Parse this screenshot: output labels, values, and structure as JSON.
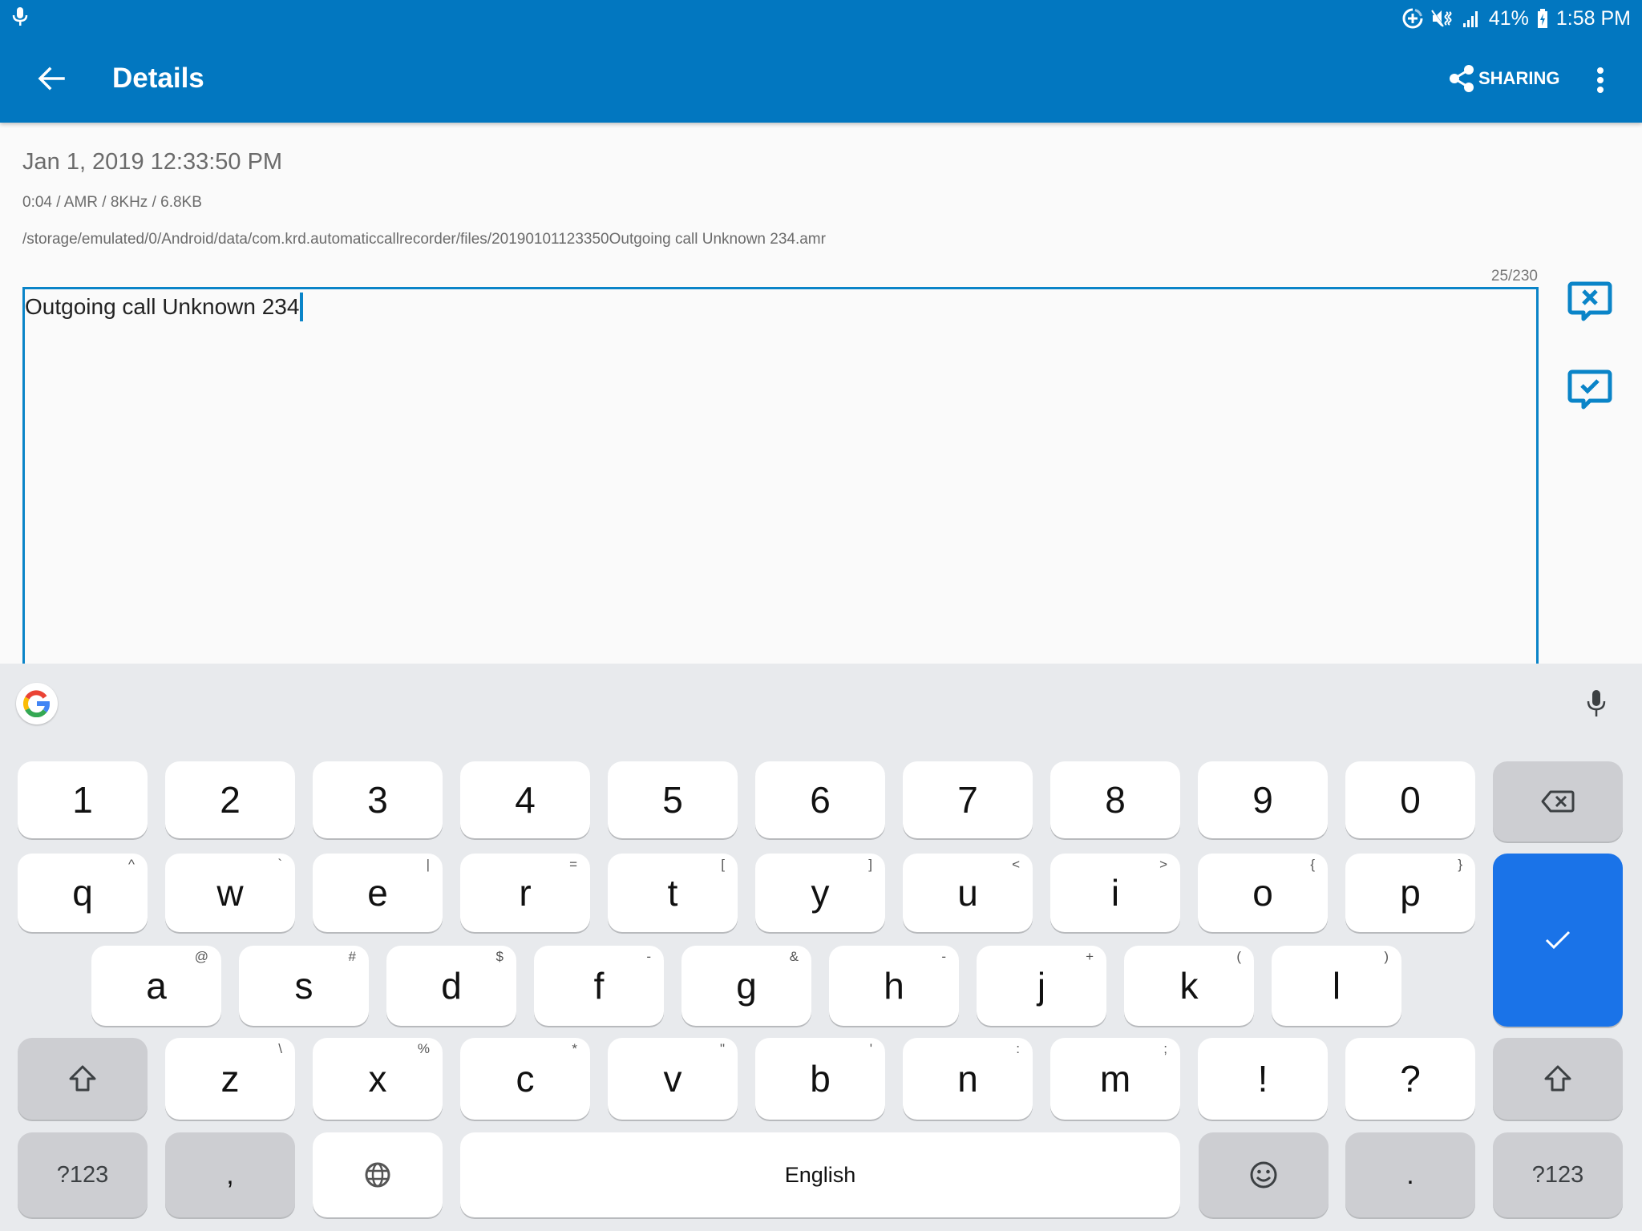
{
  "status_bar": {
    "battery": "41%",
    "time": "1:58 PM"
  },
  "app_bar": {
    "title": "Details",
    "sharing_label": "SHARING",
    "color": "#0277C0"
  },
  "recording": {
    "date": "Jan 1, 2019 12:33:50 PM",
    "meta": "0:04 / AMR / 8KHz / 6.8KB",
    "path": "/storage/emulated/0/Android/data/com.krd.automaticcallrecorder/files/20190101123350Outgoing call Unknown 234.amr"
  },
  "note": {
    "counter": "25/230",
    "value": "Outgoing call Unknown 234"
  },
  "side_actions": [
    {
      "name": "discard-note",
      "icon": "comment-x-icon"
    },
    {
      "name": "save-note",
      "icon": "comment-check-icon"
    }
  ],
  "keyboard": {
    "accent": "#1A73E8",
    "rows": [
      [
        {
          "label": "1"
        },
        {
          "label": "2"
        },
        {
          "label": "3"
        },
        {
          "label": "4"
        },
        {
          "label": "5"
        },
        {
          "label": "6"
        },
        {
          "label": "7"
        },
        {
          "label": "8"
        },
        {
          "label": "9"
        },
        {
          "label": "0"
        }
      ],
      [
        {
          "label": "q",
          "hint": "^"
        },
        {
          "label": "w",
          "hint": "`"
        },
        {
          "label": "e",
          "hint": "|"
        },
        {
          "label": "r",
          "hint": "="
        },
        {
          "label": "t",
          "hint": "["
        },
        {
          "label": "y",
          "hint": "]"
        },
        {
          "label": "u",
          "hint": "<"
        },
        {
          "label": "i",
          "hint": ">"
        },
        {
          "label": "o",
          "hint": "{"
        },
        {
          "label": "p",
          "hint": "}"
        }
      ],
      [
        {
          "label": "a",
          "hint": "@"
        },
        {
          "label": "s",
          "hint": "#"
        },
        {
          "label": "d",
          "hint": "$"
        },
        {
          "label": "f",
          "hint": "-"
        },
        {
          "label": "g",
          "hint": "&"
        },
        {
          "label": "h",
          "hint": "-"
        },
        {
          "label": "j",
          "hint": "+"
        },
        {
          "label": "k",
          "hint": "("
        },
        {
          "label": "l",
          "hint": ")"
        }
      ],
      [
        {
          "label": "z",
          "hint": "\\"
        },
        {
          "label": "x",
          "hint": "%"
        },
        {
          "label": "c",
          "hint": "*"
        },
        {
          "label": "v",
          "hint": "\""
        },
        {
          "label": "b",
          "hint": "'"
        },
        {
          "label": "n",
          "hint": ":"
        },
        {
          "label": "m",
          "hint": ";"
        },
        {
          "label": "!"
        },
        {
          "label": "?"
        }
      ]
    ],
    "bottom_row": {
      "symbols_left": "?123",
      "comma": ",",
      "space": "English",
      "period": ".",
      "symbols_right": "?123"
    }
  }
}
